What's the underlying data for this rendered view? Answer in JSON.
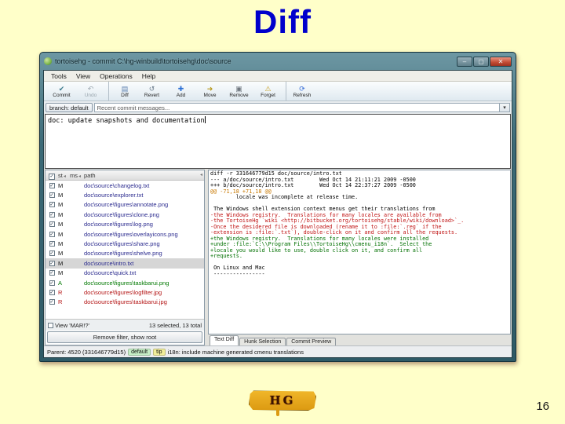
{
  "slide": {
    "title": "Diff",
    "page_number": "16",
    "logo_text": "HG",
    "background_color": "#ffffc9",
    "title_color": "#0000cc"
  },
  "window": {
    "title": "tortoisehg - commit C:\\hg-winbuild\\tortoisehg\\doc\\source",
    "menus": [
      "Tools",
      "View",
      "Operations",
      "Help"
    ],
    "toolbar": [
      {
        "label": "Commit",
        "icon": "commit-icon",
        "glyph": "✔",
        "icon_color": "#3a7a8c",
        "state": "enabled"
      },
      {
        "label": "Undo",
        "icon": "undo-icon",
        "glyph": "↶",
        "icon_color": "#9aa6ae",
        "state": "disabled"
      },
      {
        "label": "Diff",
        "icon": "diff-icon",
        "glyph": "▤",
        "icon_color": "#5b7fae",
        "state": "enabled",
        "sep": "before"
      },
      {
        "label": "Revert",
        "icon": "revert-icon",
        "glyph": "↺",
        "icon_color": "#6b7b8c",
        "state": "enabled"
      },
      {
        "label": "Add",
        "icon": "add-icon",
        "glyph": "✚",
        "icon_color": "#2b6fd4",
        "state": "enabled"
      },
      {
        "label": "Move",
        "icon": "move-icon",
        "glyph": "➜",
        "icon_color": "#b89a20",
        "state": "enabled"
      },
      {
        "label": "Remove",
        "icon": "remove-icon",
        "glyph": "▣",
        "icon_color": "#707880",
        "state": "enabled"
      },
      {
        "label": "Forget",
        "icon": "forget-icon",
        "glyph": "⚠",
        "icon_color": "#c9a227",
        "state": "enabled"
      },
      {
        "label": "Refresh",
        "icon": "refresh-icon",
        "glyph": "⟳",
        "icon_color": "#3a6fd8",
        "state": "enabled",
        "sep": "before"
      }
    ],
    "branch_button": "branch: default",
    "recent_messages": "Recent commit messages...",
    "commit_message": "doc: update snapshots and documentation",
    "file_list": {
      "columns": {
        "st": "st",
        "ms": "ms",
        "path": "path"
      },
      "rows": [
        {
          "st": "M",
          "ms": "",
          "path": "doc\\source\\changelog.txt",
          "status": "modified",
          "checked": "on"
        },
        {
          "st": "M",
          "ms": "",
          "path": "doc\\source\\explorer.txt",
          "status": "modified",
          "checked": "on"
        },
        {
          "st": "M",
          "ms": "",
          "path": "doc\\source\\figures\\annotate.png",
          "status": "modified",
          "checked": "on"
        },
        {
          "st": "M",
          "ms": "",
          "path": "doc\\source\\figures\\clone.png",
          "status": "modified",
          "checked": "on"
        },
        {
          "st": "M",
          "ms": "",
          "path": "doc\\source\\figures\\log.png",
          "status": "modified",
          "checked": "on"
        },
        {
          "st": "M",
          "ms": "",
          "path": "doc\\source\\figures\\overlayicons.png",
          "status": "modified",
          "checked": "on"
        },
        {
          "st": "M",
          "ms": "",
          "path": "doc\\source\\figures\\share.png",
          "status": "modified",
          "checked": "on"
        },
        {
          "st": "M",
          "ms": "",
          "path": "doc\\source\\figures\\shelve.png",
          "status": "modified",
          "checked": "on"
        },
        {
          "st": "M",
          "ms": "",
          "path": "doc\\source\\intro.txt",
          "status": "modified",
          "checked": "on",
          "selected": "selected"
        },
        {
          "st": "M",
          "ms": "",
          "path": "doc\\source\\quick.txt",
          "status": "modified",
          "checked": "on"
        },
        {
          "st": "A",
          "ms": "",
          "path": "doc\\source\\figures\\taskbarui.png",
          "status": "added",
          "checked": "on"
        },
        {
          "st": "R",
          "ms": "",
          "path": "doc\\source\\figures\\logfilter.jpg",
          "status": "removed",
          "checked": "on"
        },
        {
          "st": "R",
          "ms": "",
          "path": "doc\\source\\figures\\taskbarui.jpg",
          "status": "removed",
          "checked": "on"
        }
      ],
      "filter_label": "View 'MAR!?'",
      "selection_summary": "13 selected, 13 total",
      "remove_filter_button": "Remove filter, show root"
    },
    "diff": {
      "lines": [
        {
          "text": "diff -r 331646779d15 doc/source/intro.txt",
          "type": "header"
        },
        {
          "text": "--- a/doc/source/intro.txt        Wed Oct 14 21:11:21 2009 -0500",
          "type": "header"
        },
        {
          "text": "+++ b/doc/source/intro.txt        Wed Oct 14 22:37:27 2009 -0500",
          "type": "header"
        },
        {
          "text": "@@ -71,18 +71,18 @@",
          "type": "hunk"
        },
        {
          "text": "        locale was incomplete at release time.",
          "type": "context"
        },
        {
          "text": " ",
          "type": "context"
        },
        {
          "text": " The Windows shell extension context menus get their translations from",
          "type": "context"
        },
        {
          "text": "-the Windows registry.  Translations for many locales are available from",
          "type": "removed"
        },
        {
          "text": "-the TortoiseHg `wiki <http://bitbucket.org/tortoisehg/stable/wiki/download>`_.",
          "type": "removed"
        },
        {
          "text": "-Once the desidered file is downloaded (rename it to :file:`.reg` if the",
          "type": "removed"
        },
        {
          "text": "-extension is :file:`.txt`), double-click on it and confirm all the requests.",
          "type": "removed"
        },
        {
          "text": "+the Windows registry.  Translations for many locales were installed",
          "type": "added"
        },
        {
          "text": "+under :file:`C:\\\\Program Files\\\\TortoiseHg\\\\cmenu_i18n`.  Select the",
          "type": "added"
        },
        {
          "text": "+locale you would like to use, double click on it, and confirm all",
          "type": "added"
        },
        {
          "text": "+requests.",
          "type": "added"
        },
        {
          "text": " ",
          "type": "context"
        },
        {
          "text": " On Linux and Mac",
          "type": "context"
        },
        {
          "text": " ----------------",
          "type": "context"
        }
      ],
      "tabs": [
        {
          "label": "Text Diff",
          "state": "active"
        },
        {
          "label": "Hunk Selection",
          "state": "inactive"
        },
        {
          "label": "Commit Preview",
          "state": "inactive"
        }
      ]
    },
    "status_bar": {
      "parent_text": "Parent: 4520  (331646779d15)",
      "badges": [
        {
          "label": "default",
          "color": "#c6efc6"
        },
        {
          "label": "tip",
          "color": "#f0ee9a"
        }
      ],
      "message": "i18n: include machine generated cmenu translations"
    }
  }
}
